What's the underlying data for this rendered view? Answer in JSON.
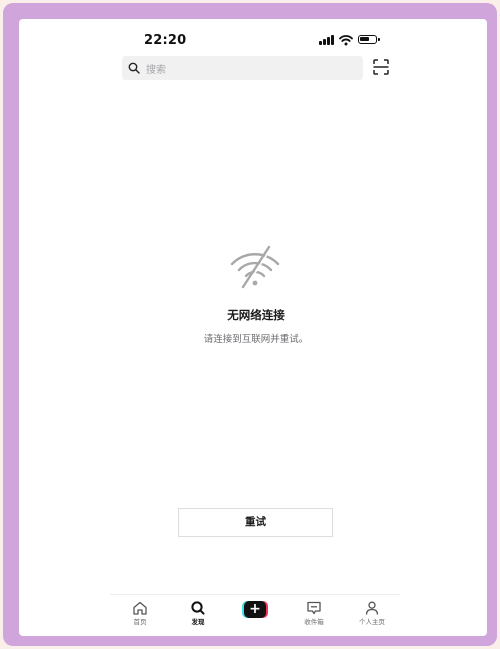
{
  "status_bar": {
    "time": "22:20",
    "signal_icon": "cellular-signal-icon",
    "wifi_icon": "wifi-icon",
    "battery_icon": "battery-icon"
  },
  "search": {
    "placeholder": "搜索",
    "scan_icon": "scan-icon"
  },
  "empty_state": {
    "icon": "no-wifi-icon",
    "title": "无网络连接",
    "subtitle": "请连接到互联网并重试。",
    "retry_label": "重试"
  },
  "tabbar": {
    "items": [
      {
        "label": "首页",
        "icon": "home-icon"
      },
      {
        "label": "发现",
        "icon": "search-icon",
        "active": true
      },
      {
        "label": "",
        "icon": "plus-icon"
      },
      {
        "label": "收件箱",
        "icon": "inbox-icon"
      },
      {
        "label": "个人主页",
        "icon": "profile-icon"
      }
    ]
  },
  "colors": {
    "frame": "#cfa5dc",
    "background": "#fbefea",
    "accent_cyan": "#40e0e8",
    "accent_red": "#f2325a"
  }
}
